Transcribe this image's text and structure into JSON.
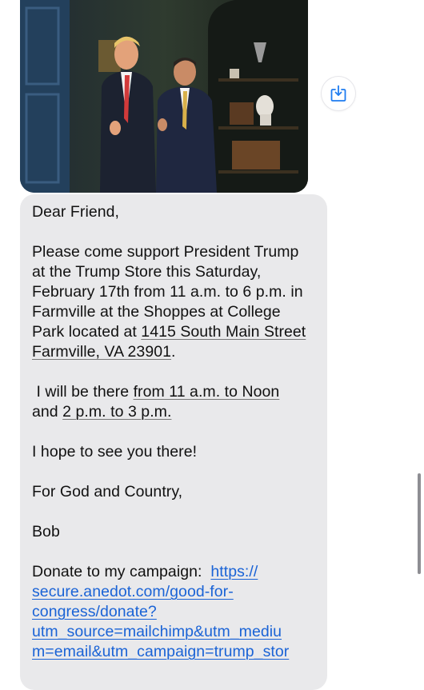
{
  "message": {
    "greeting": "Dear Friend,",
    "para1": {
      "text": "Please come support President Trump at the Trump Store this Saturday, February 17th from 11 a.m. to 6 p.m. in Farmville at the Shoppes at College Park located at ",
      "address": "1415 South Main Street Farmville, VA 23901",
      "end": "."
    },
    "para2": {
      "start": " I will be there ",
      "time1": "from 11 a.m. to Noon",
      "and": " and ",
      "time2": "2 p.m. to 3 p.m.",
      "end": ""
    },
    "para3": "I hope to see you there!",
    "closing": "For God and Country,",
    "signature": "Bob",
    "donate_label": "Donate to my campaign:  ",
    "donate_url_lines": [
      "https://",
      "secure.anedot.com/good-for-",
      "congress/donate?",
      "utm_source=mailchimp&utm_mediu",
      "m=email&utm_campaign=trump_stor"
    ]
  },
  "icons": {
    "save": "save-to-photos-icon"
  },
  "colors": {
    "bubble": "#e9e9eb",
    "link": "#1a63d6",
    "icon": "#1e7cf0"
  }
}
